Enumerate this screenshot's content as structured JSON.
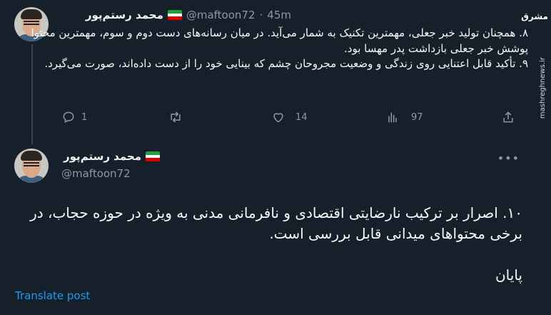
{
  "tweet1": {
    "name": "محمد رستم‌پور",
    "handle": "@maftoon72",
    "separator": "·",
    "time": "45m",
    "paragraphs": [
      "۸. همچنان تولید خبر جعلی، مهمترین تکنیک به شمار می‌آید. در میان رسانه‌های دست دوم و سوم، مهمترین محتوا پوشش خبر جعلی بازداشت پدر مهسا بود.",
      "۹. تأکید قابل اعتنایی روی زندگی و وضعیت مجروحان چشم که بینایی خود را از دست داده‌اند، صورت می‌گیرد."
    ],
    "actions": {
      "replies": "1",
      "retweets": "",
      "likes": "14",
      "views": "97"
    }
  },
  "tweet2": {
    "name": "محمد رستم‌پور",
    "handle": "@maftoon72",
    "more": "•••",
    "paragraphs": [
      "۱۰. اصرار بر ترکیب نارضایتی اقتصادی و نافرمانی مدنی به ویژه در حوزه حجاب، در برخی محتواهای میدانی قابل بررسی است."
    ],
    "closing": "پایان",
    "translate_label": "Translate post"
  },
  "watermark": {
    "logo": "مشرق",
    "url": "mashreghnews.ir"
  },
  "colors": {
    "background": "#15202b",
    "text": "#f7f9f9",
    "muted": "#8b98a5",
    "link": "#1d9bf0"
  },
  "icons": [
    "reply-icon",
    "retweet-icon",
    "like-icon",
    "views-icon",
    "share-icon",
    "more-icon",
    "iran-flag-icon"
  ]
}
